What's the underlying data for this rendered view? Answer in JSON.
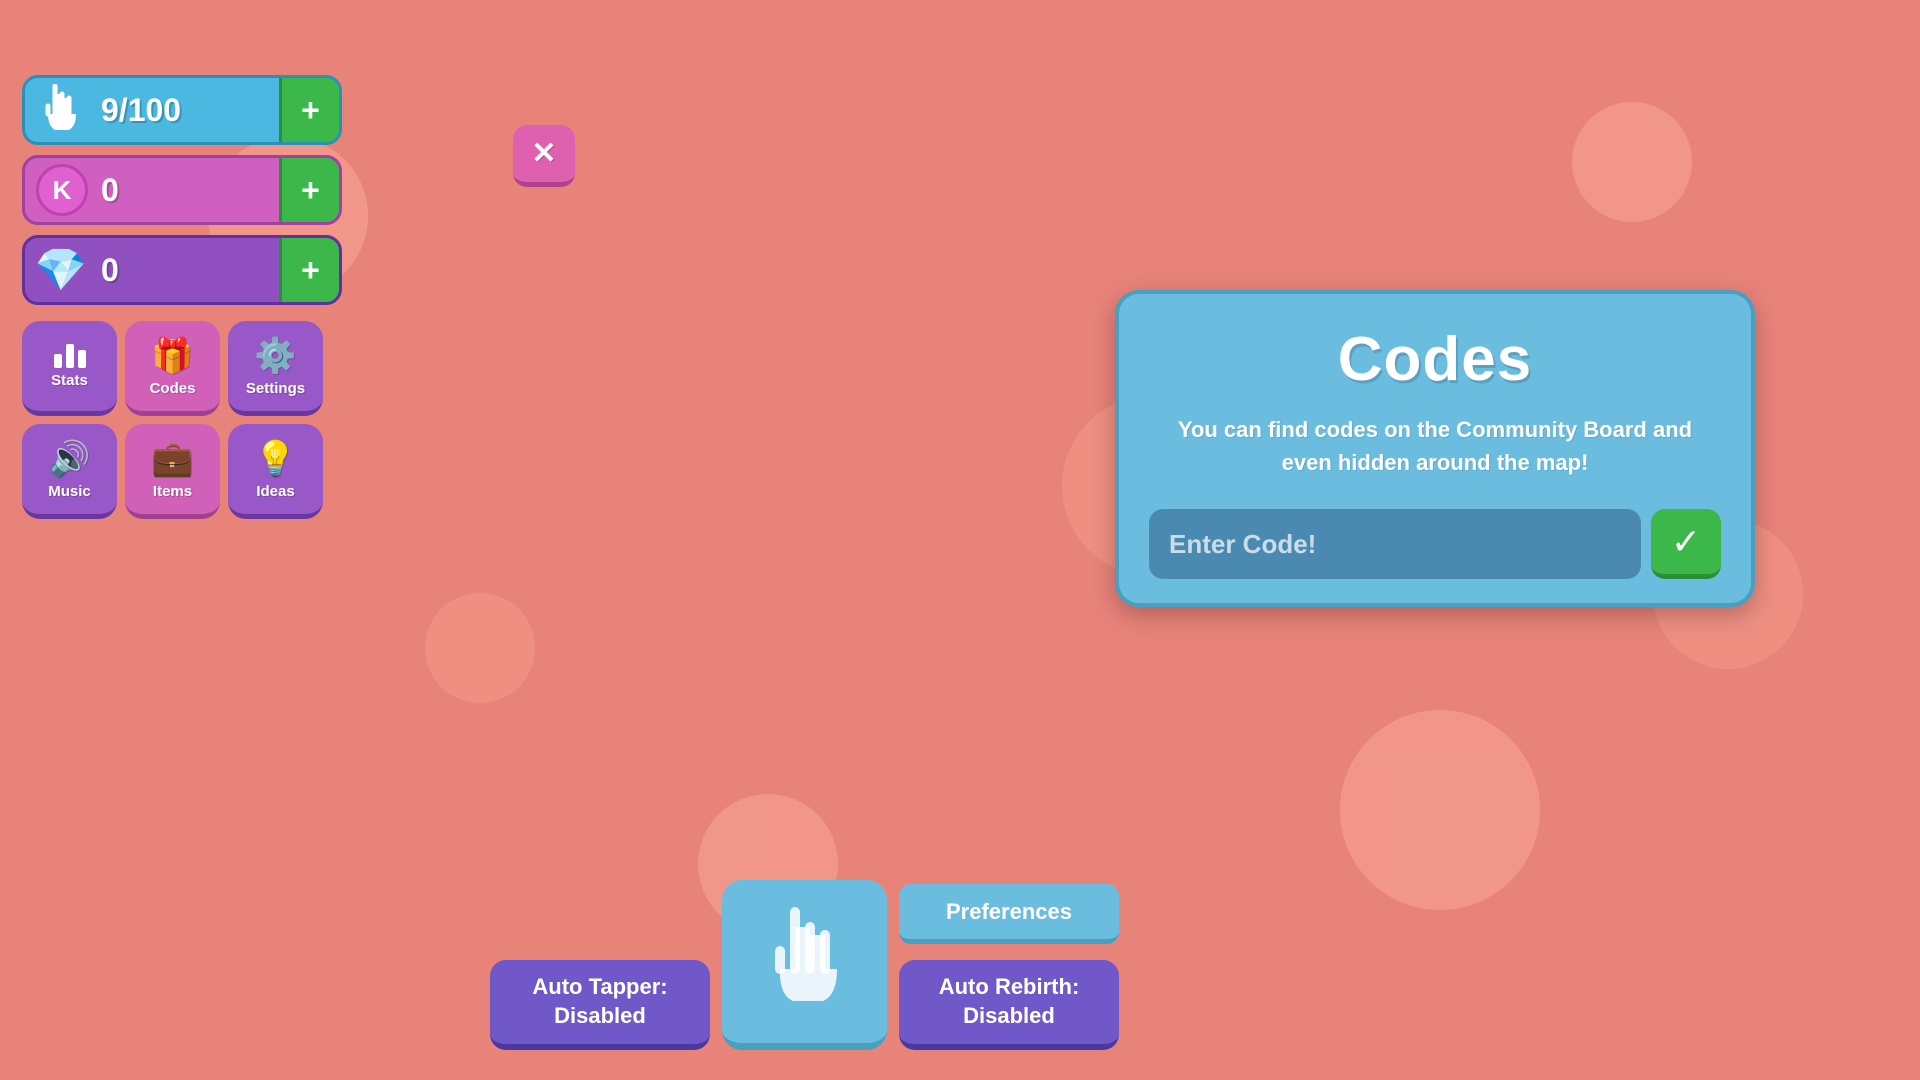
{
  "resources": {
    "taps": {
      "value": "9/100",
      "plus_label": "+"
    },
    "kash": {
      "value": "0",
      "plus_label": "+"
    },
    "gems": {
      "value": "0",
      "plus_label": "+"
    }
  },
  "nav_buttons": {
    "stats": {
      "label": "Stats"
    },
    "codes": {
      "label": "Codes"
    },
    "settings": {
      "label": "Settings"
    },
    "music": {
      "label": "Music"
    },
    "items": {
      "label": "Items"
    },
    "ideas": {
      "label": "Ideas"
    }
  },
  "codes_dialog": {
    "title": "Codes",
    "description": "You can find codes on the Community Board and even hidden around the map!",
    "input_placeholder": "Enter Code!",
    "submit_label": "✓"
  },
  "bottom_bar": {
    "auto_tapper": "Auto Tapper:\nDisabled",
    "auto_rebirth": "Auto Rebirth:\nDisabled",
    "preferences": "Preferences"
  },
  "close_btn": "✕"
}
